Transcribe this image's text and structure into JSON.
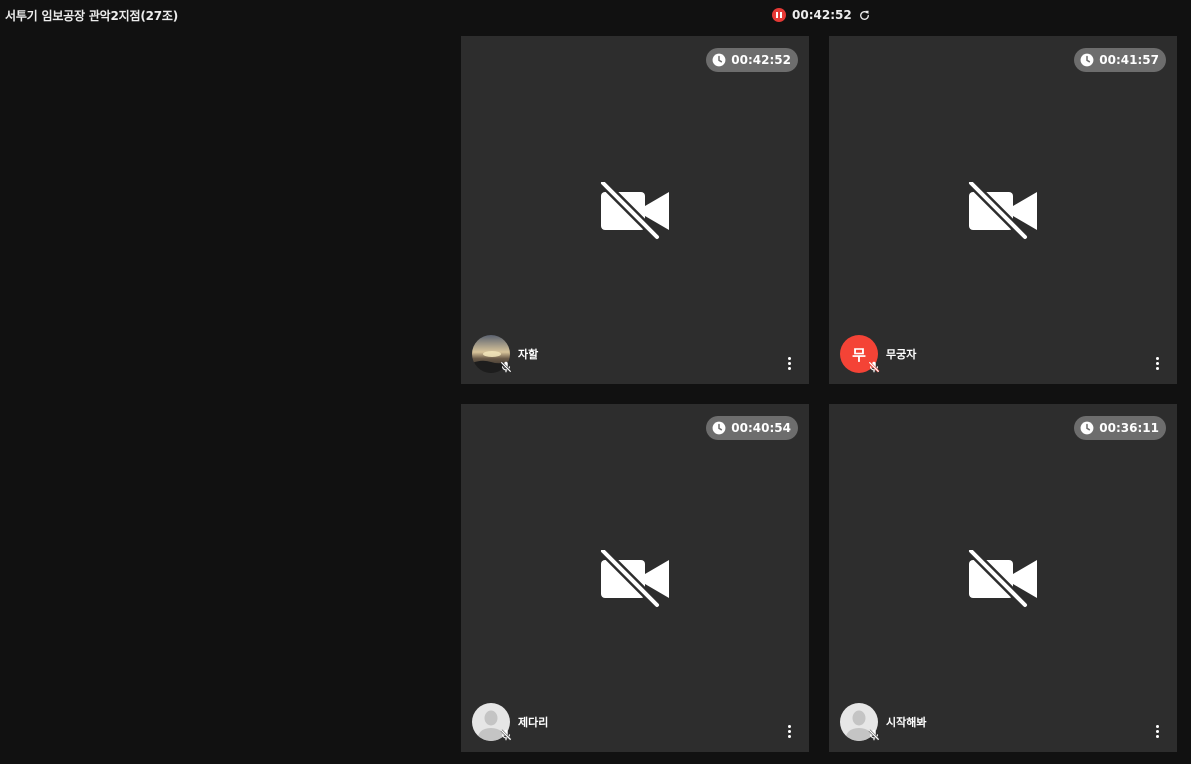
{
  "room": {
    "title": "서투기 임보공장 관악2지점(27조)"
  },
  "session": {
    "elapsed": "00:42:52",
    "status_icon": "pause-icon",
    "refresh_icon": "refresh-icon"
  },
  "colors": {
    "background": "#111111",
    "tile": "#2d2d2d",
    "badge": "#6d6d6d",
    "recording": "#e53935",
    "letter_avatar": "#f44336"
  },
  "participants": [
    {
      "name": "자할",
      "timer": "00:42:52",
      "avatar_type": "photo",
      "mic": "off",
      "camera": "off"
    },
    {
      "name": "무궁자",
      "timer": "00:41:57",
      "avatar_type": "letter",
      "avatar_letter": "무",
      "mic": "off",
      "camera": "off"
    },
    {
      "name": "제다리",
      "timer": "00:40:54",
      "avatar_type": "default",
      "mic": "off",
      "camera": "off"
    },
    {
      "name": "시작해봐",
      "timer": "00:36:11",
      "avatar_type": "default",
      "mic": "off",
      "camera": "off"
    }
  ]
}
